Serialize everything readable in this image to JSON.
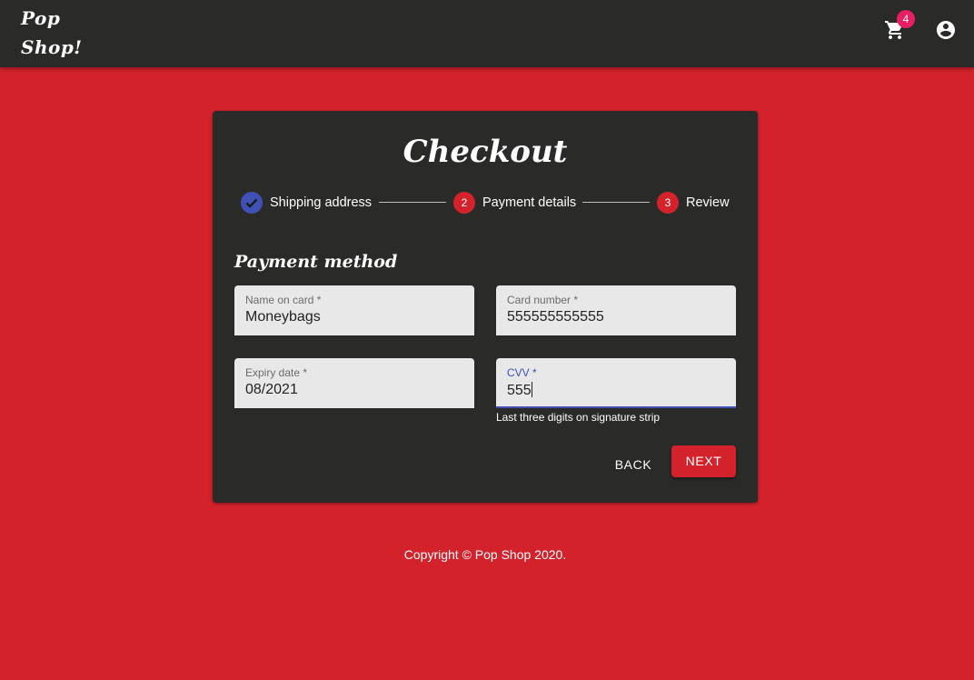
{
  "header": {
    "logo_line1": "Pop",
    "logo_line2": "Shop!",
    "cart_count": "4",
    "cart_icon": "cart-icon",
    "account_icon": "account-circle-icon"
  },
  "checkout": {
    "title": "Checkout",
    "steps": [
      {
        "label": "Shipping address",
        "icon": "check-icon",
        "state": "completed"
      },
      {
        "label": "Payment details",
        "number": "2",
        "state": "active"
      },
      {
        "label": "Review",
        "number": "3",
        "state": "pending"
      }
    ],
    "section_title": "Payment method",
    "fields": {
      "name_on_card": {
        "label": "Name on card *",
        "value": "Moneybags"
      },
      "card_number": {
        "label": "Card number *",
        "value": "555555555555"
      },
      "expiry_date": {
        "label": "Expiry date *",
        "value": "08/2021"
      },
      "cvv": {
        "label": "CVV *",
        "value": "555",
        "helper": "Last three digits on signature strip"
      }
    },
    "back_label": "BACK",
    "next_label": "NEXT"
  },
  "footer": {
    "copyright": "Copyright © Pop Shop 2020."
  },
  "colors": {
    "background": "#d3222b",
    "surface": "#2a2a29",
    "accent_blue": "#3f51b5",
    "badge_pink": "#e91e63"
  }
}
